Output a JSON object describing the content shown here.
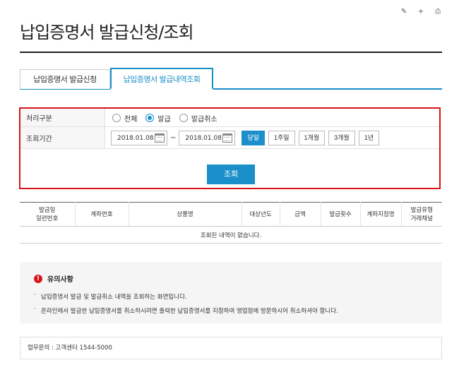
{
  "util_icons": [
    "edit-icon",
    "add-icon",
    "print-icon"
  ],
  "page_title": "납입증명서 발급신청/조회",
  "tabs": [
    {
      "label": "납입증명서 발급신청"
    },
    {
      "label": "납입증명서 발급내역조회"
    }
  ],
  "search": {
    "type_label": "처리구분",
    "type_options": [
      "전체",
      "발급",
      "발급취소"
    ],
    "type_selected": "발급",
    "period_label": "조회기간",
    "date_from": "2018.01.08",
    "date_to": "2018.01.08",
    "tilde": "~",
    "period_buttons": [
      "당일",
      "1주일",
      "1개월",
      "3개월",
      "1년"
    ],
    "period_selected": "당일",
    "submit_label": "조회"
  },
  "table": {
    "headers": [
      [
        "발급일",
        "일련번호"
      ],
      [
        "계좌번호"
      ],
      [
        "상품명"
      ],
      [
        "대상년도"
      ],
      [
        "금액"
      ],
      [
        "발급횟수"
      ],
      [
        "계좌지점명"
      ],
      [
        "발급유형",
        "거래채널"
      ]
    ],
    "empty_message": "조회된 내역이 없습니다."
  },
  "notice": {
    "title": "유의사항",
    "items": [
      "납입증명서 발급 및 발급취소 내역을 조회하는 화면입니다.",
      "온라인에서 발급한 납입증명서를 취소하시려면 출력한 납입증명서를 지참하여 영업점에 방문하시어 취소하셔야 합니다."
    ]
  },
  "contact": "업무문의 : 고객센터 1544-5000",
  "colors": {
    "accent": "#1a8fc9",
    "highlight": "#d7141a"
  }
}
